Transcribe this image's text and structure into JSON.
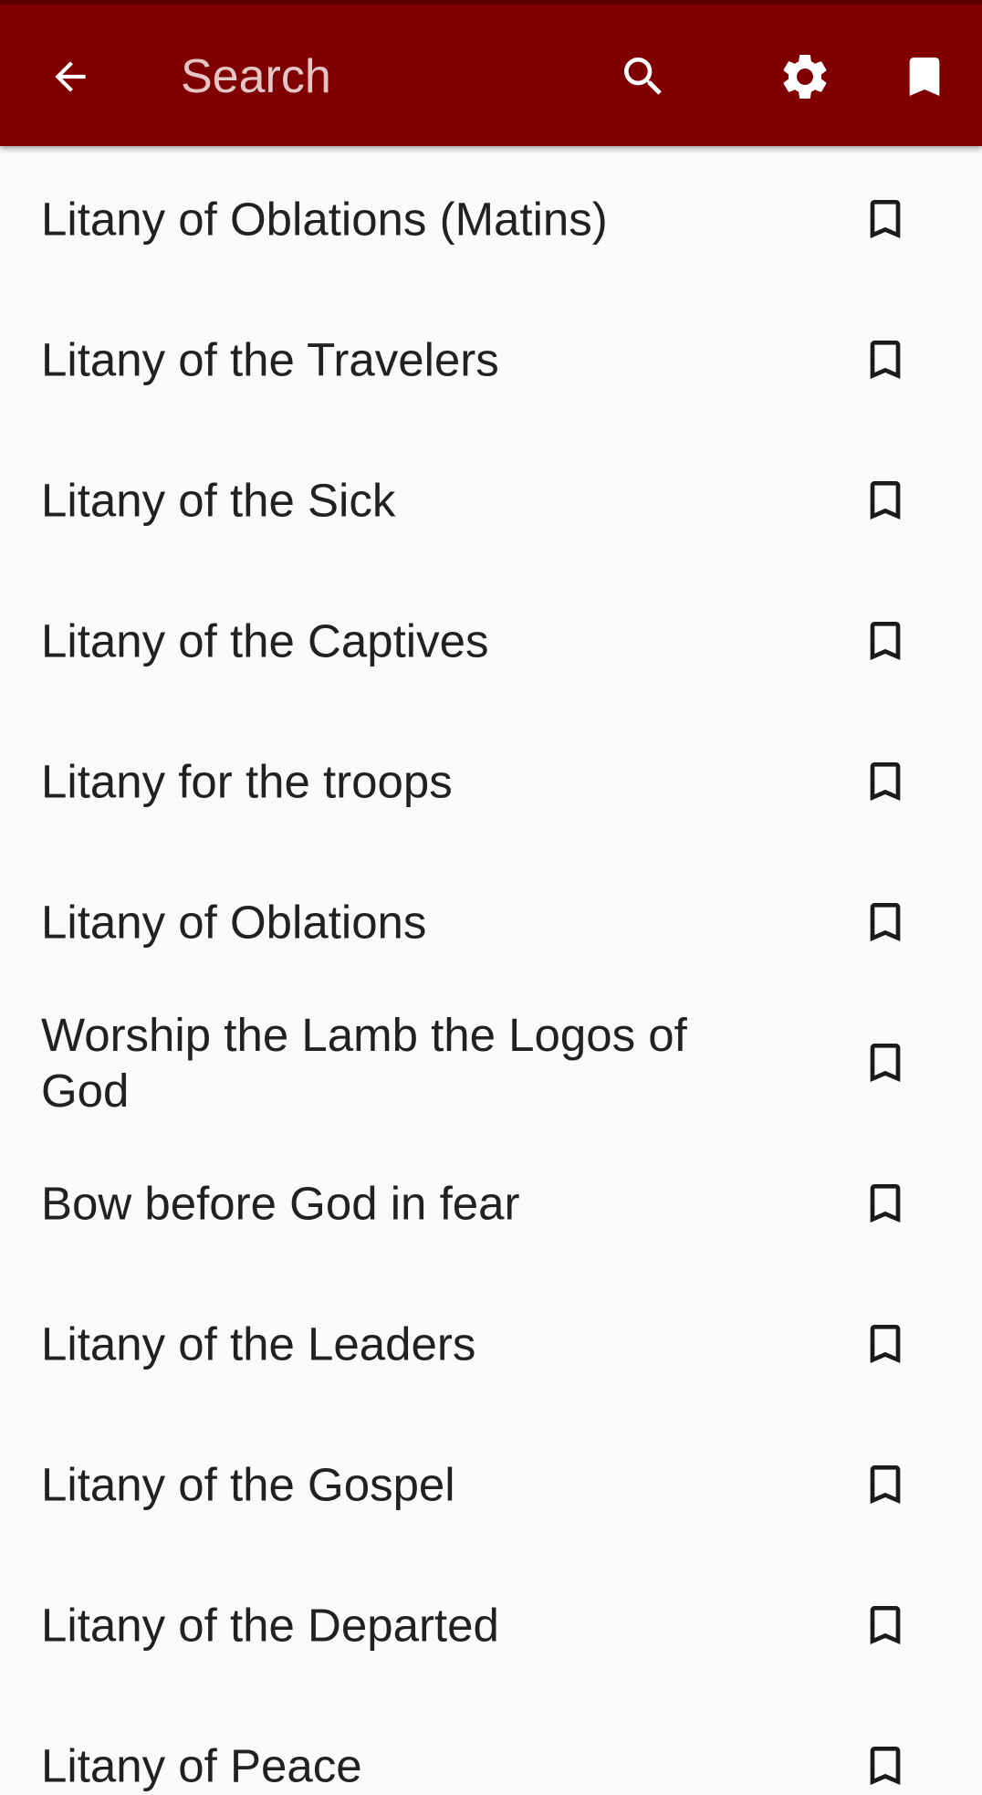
{
  "header": {
    "search_placeholder": "Search",
    "background_color": "#800000",
    "back_icon": "arrow-back-icon",
    "search_icon": "search-icon",
    "settings_icon": "gear-icon",
    "bookmarks_icon": "bookmark-filled-icon"
  },
  "list": {
    "bookmark_icon": "bookmark-outline-icon",
    "items": [
      {
        "label": "Litany of Oblations (Matins)"
      },
      {
        "label": "Litany of the Travelers"
      },
      {
        "label": "Litany of the Sick"
      },
      {
        "label": "Litany of the Captives"
      },
      {
        "label": "Litany for the troops"
      },
      {
        "label": "Litany of Oblations"
      },
      {
        "label": "Worship the Lamb the Logos of God"
      },
      {
        "label": "Bow before God in fear"
      },
      {
        "label": "Litany of the Leaders"
      },
      {
        "label": "Litany of the Gospel"
      },
      {
        "label": "Litany of the Departed"
      },
      {
        "label": "Litany of Peace"
      }
    ]
  }
}
